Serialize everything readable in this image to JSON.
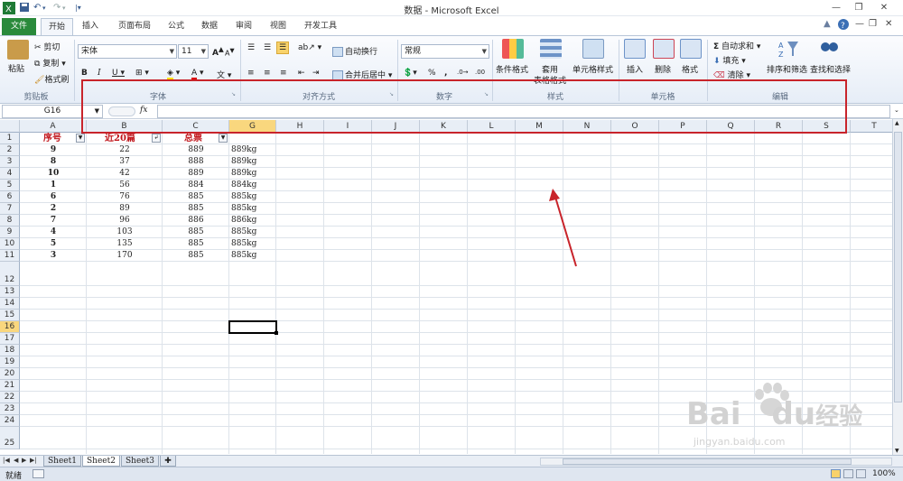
{
  "window": {
    "title": "数据 - Microsoft Excel",
    "app_icon": "excel-icon"
  },
  "quick_access": [
    "save-icon",
    "undo-icon",
    "redo-icon",
    "customize-icon"
  ],
  "tabs": [
    {
      "label": "文件",
      "active": false
    },
    {
      "label": "开始",
      "active": true
    },
    {
      "label": "插入",
      "active": false
    },
    {
      "label": "页面布局",
      "active": false
    },
    {
      "label": "公式",
      "active": false
    },
    {
      "label": "数据",
      "active": false
    },
    {
      "label": "审阅",
      "active": false
    },
    {
      "label": "视图",
      "active": false
    },
    {
      "label": "开发工具",
      "active": false
    }
  ],
  "ribbon": {
    "clipboard": {
      "paste": "粘贴",
      "cut": "剪切",
      "copy": "复制",
      "format_painter": "格式刷",
      "group": "剪贴板"
    },
    "font": {
      "font_name": "宋体",
      "font_size": "11",
      "bold": "B",
      "italic": "I",
      "underline": "U",
      "grow": "A",
      "shrink": "A",
      "group": "字体"
    },
    "alignment": {
      "wrap": "自动换行",
      "merge": "合并后居中",
      "group": "对齐方式"
    },
    "number": {
      "format": "常规",
      "percent": "%",
      "comma": ",",
      "group": "数字"
    },
    "styles": {
      "conditional": "条件格式",
      "table": "套用",
      "table2": "表格格式",
      "cell_styles": "单元格样式",
      "group": "样式"
    },
    "cells": {
      "insert": "插入",
      "delete": "删除",
      "format": "格式",
      "group": "单元格"
    },
    "editing": {
      "autosum": "自动求和",
      "fill": "填充",
      "clear": "清除",
      "sort": "排序和筛选",
      "find": "查找和选择",
      "group": "编辑"
    }
  },
  "formula_bar": {
    "name_box": "G16",
    "fx": "fx",
    "formula": ""
  },
  "columns": [
    "A",
    "B",
    "C",
    "G",
    "H",
    "I",
    "J",
    "K",
    "L",
    "M",
    "N",
    "O",
    "P",
    "Q",
    "R",
    "S",
    "T"
  ],
  "selected_column": "G",
  "rows": [
    "1",
    "2",
    "3",
    "4",
    "5",
    "6",
    "7",
    "8",
    "9",
    "10",
    "11",
    "12",
    "13",
    "14",
    "15",
    "16",
    "17",
    "18",
    "19",
    "20",
    "21",
    "22",
    "23",
    "24",
    "25"
  ],
  "selected_row": "16",
  "table": {
    "headers": [
      "序号",
      "近20篇",
      "总票"
    ],
    "data": [
      [
        "9",
        "22",
        "889",
        "889kg"
      ],
      [
        "8",
        "37",
        "888",
        "889kg"
      ],
      [
        "10",
        "42",
        "889",
        "889kg"
      ],
      [
        "1",
        "56",
        "884",
        "884kg"
      ],
      [
        "6",
        "76",
        "885",
        "885kg"
      ],
      [
        "2",
        "89",
        "885",
        "885kg"
      ],
      [
        "7",
        "96",
        "886",
        "886kg"
      ],
      [
        "4",
        "103",
        "885",
        "885kg"
      ],
      [
        "5",
        "135",
        "885",
        "885kg"
      ],
      [
        "3",
        "170",
        "885",
        "885kg"
      ]
    ]
  },
  "sheets": [
    {
      "name": "Sheet1",
      "active": false
    },
    {
      "name": "Sheet2",
      "active": true
    },
    {
      "name": "Sheet3",
      "active": false
    }
  ],
  "status": {
    "ready": "就绪",
    "zoom": "100%"
  },
  "watermark": {
    "brand": "Bai",
    "brand_suffix": "经验",
    "url": "jingyan.baidu.com"
  },
  "colors": {
    "file_tab": "#2a8a3b",
    "header_text": "#c0151b",
    "annotation": "#c8242b",
    "selection_header": "#f9d77e"
  }
}
